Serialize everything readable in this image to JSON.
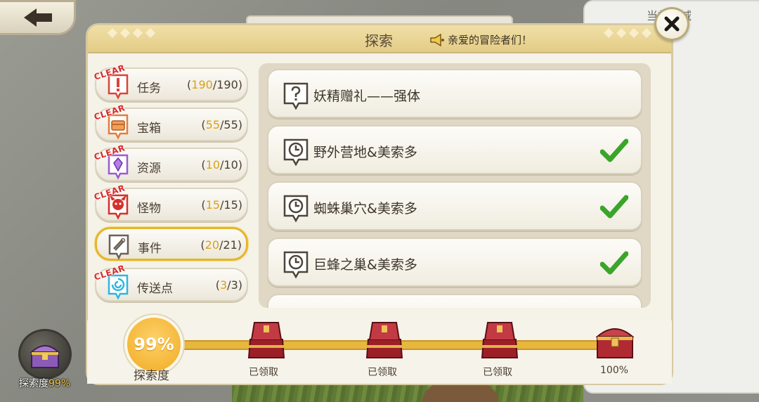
{
  "background": {
    "right_panel_text": "当前区域"
  },
  "dialog": {
    "title": "探索",
    "subtitle": "亲爱的冒险者们！"
  },
  "categories": [
    {
      "label": "任务",
      "done": "190",
      "total": "190",
      "clear": true,
      "icon": "exclamation-icon",
      "color": "#d9443a"
    },
    {
      "label": "宝箱",
      "done": "55",
      "total": "55",
      "clear": true,
      "icon": "chest-icon",
      "color": "#e67c38"
    },
    {
      "label": "资源",
      "done": "10",
      "total": "10",
      "clear": true,
      "icon": "crystal-icon",
      "color": "#9b5bd1"
    },
    {
      "label": "怪物",
      "done": "15",
      "total": "15",
      "clear": true,
      "icon": "monster-icon",
      "color": "#d6302a"
    },
    {
      "label": "事件",
      "done": "20",
      "total": "21",
      "clear": false,
      "icon": "scroll-icon",
      "color": "#6b6158"
    },
    {
      "label": "传送点",
      "done": "3",
      "total": "3",
      "clear": true,
      "icon": "portal-icon",
      "color": "#2fb5e0"
    }
  ],
  "clear_text": "CLEAR",
  "events": [
    {
      "label": "妖精赠礼——强体",
      "icon": "question-icon",
      "completed": false
    },
    {
      "label": "野外营地&美索多",
      "icon": "clock-icon",
      "completed": true
    },
    {
      "label": "蜘蛛巢穴&美索多",
      "icon": "clock-icon",
      "completed": true
    },
    {
      "label": "巨蜂之巢&美索多",
      "icon": "clock-icon",
      "completed": true
    }
  ],
  "progress": {
    "percent_label": "99%",
    "percent_value": 99,
    "caption": "探索度",
    "rewards": [
      {
        "label": "已领取",
        "claimed": true
      },
      {
        "label": "已领取",
        "claimed": true
      },
      {
        "label": "已领取",
        "claimed": true
      },
      {
        "label": "100%",
        "claimed": false
      }
    ]
  },
  "explore_badge": {
    "caption": "探索度",
    "value": "99%"
  },
  "colors": {
    "accent_gold": "#e5b52c",
    "check_green": "#3aa52a",
    "clear_red": "#d62b2b"
  }
}
